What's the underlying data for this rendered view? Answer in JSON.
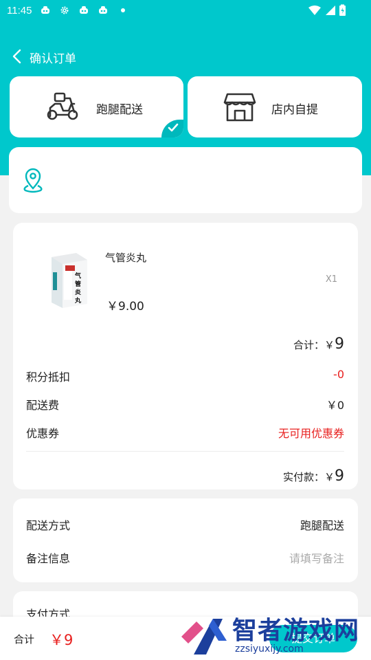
{
  "status_bar": {
    "time": "11:45"
  },
  "nav": {
    "title": "确认订单"
  },
  "delivery_modes": [
    {
      "label": "跑腿配送",
      "icon": "scooter-icon",
      "selected": true
    },
    {
      "label": "店内自提",
      "icon": "store-icon",
      "selected": false
    }
  ],
  "address": {
    "icon": "location-pin-icon"
  },
  "order": {
    "product": {
      "name": "气管炎丸",
      "qty": "X1",
      "price": "￥9.00",
      "box_text": "气管炎丸"
    },
    "subtotal_label": "合计：",
    "subtotal_currency": "￥",
    "subtotal_value": "9",
    "points_label": "积分抵扣",
    "points_value": "-0",
    "shipping_label": "配送费",
    "shipping_value": "￥0",
    "coupon_label": "优惠券",
    "coupon_value": "无可用优惠券",
    "paid_label": "实付款：",
    "paid_currency": "￥",
    "paid_value": "9"
  },
  "info": {
    "delivery_label": "配送方式",
    "delivery_value": "跑腿配送",
    "note_label": "备注信息",
    "note_placeholder": "请填写备注"
  },
  "payment": {
    "label": "支付方式"
  },
  "bottom": {
    "total_label": "合计",
    "total_value": "￥9",
    "submit_label": "提交订单"
  },
  "watermark": {
    "title": "智者游戏网",
    "sub": "zzsiyuxijy.com"
  },
  "colors": {
    "accent": "#00c8cc",
    "price_red": "#e8201f"
  }
}
